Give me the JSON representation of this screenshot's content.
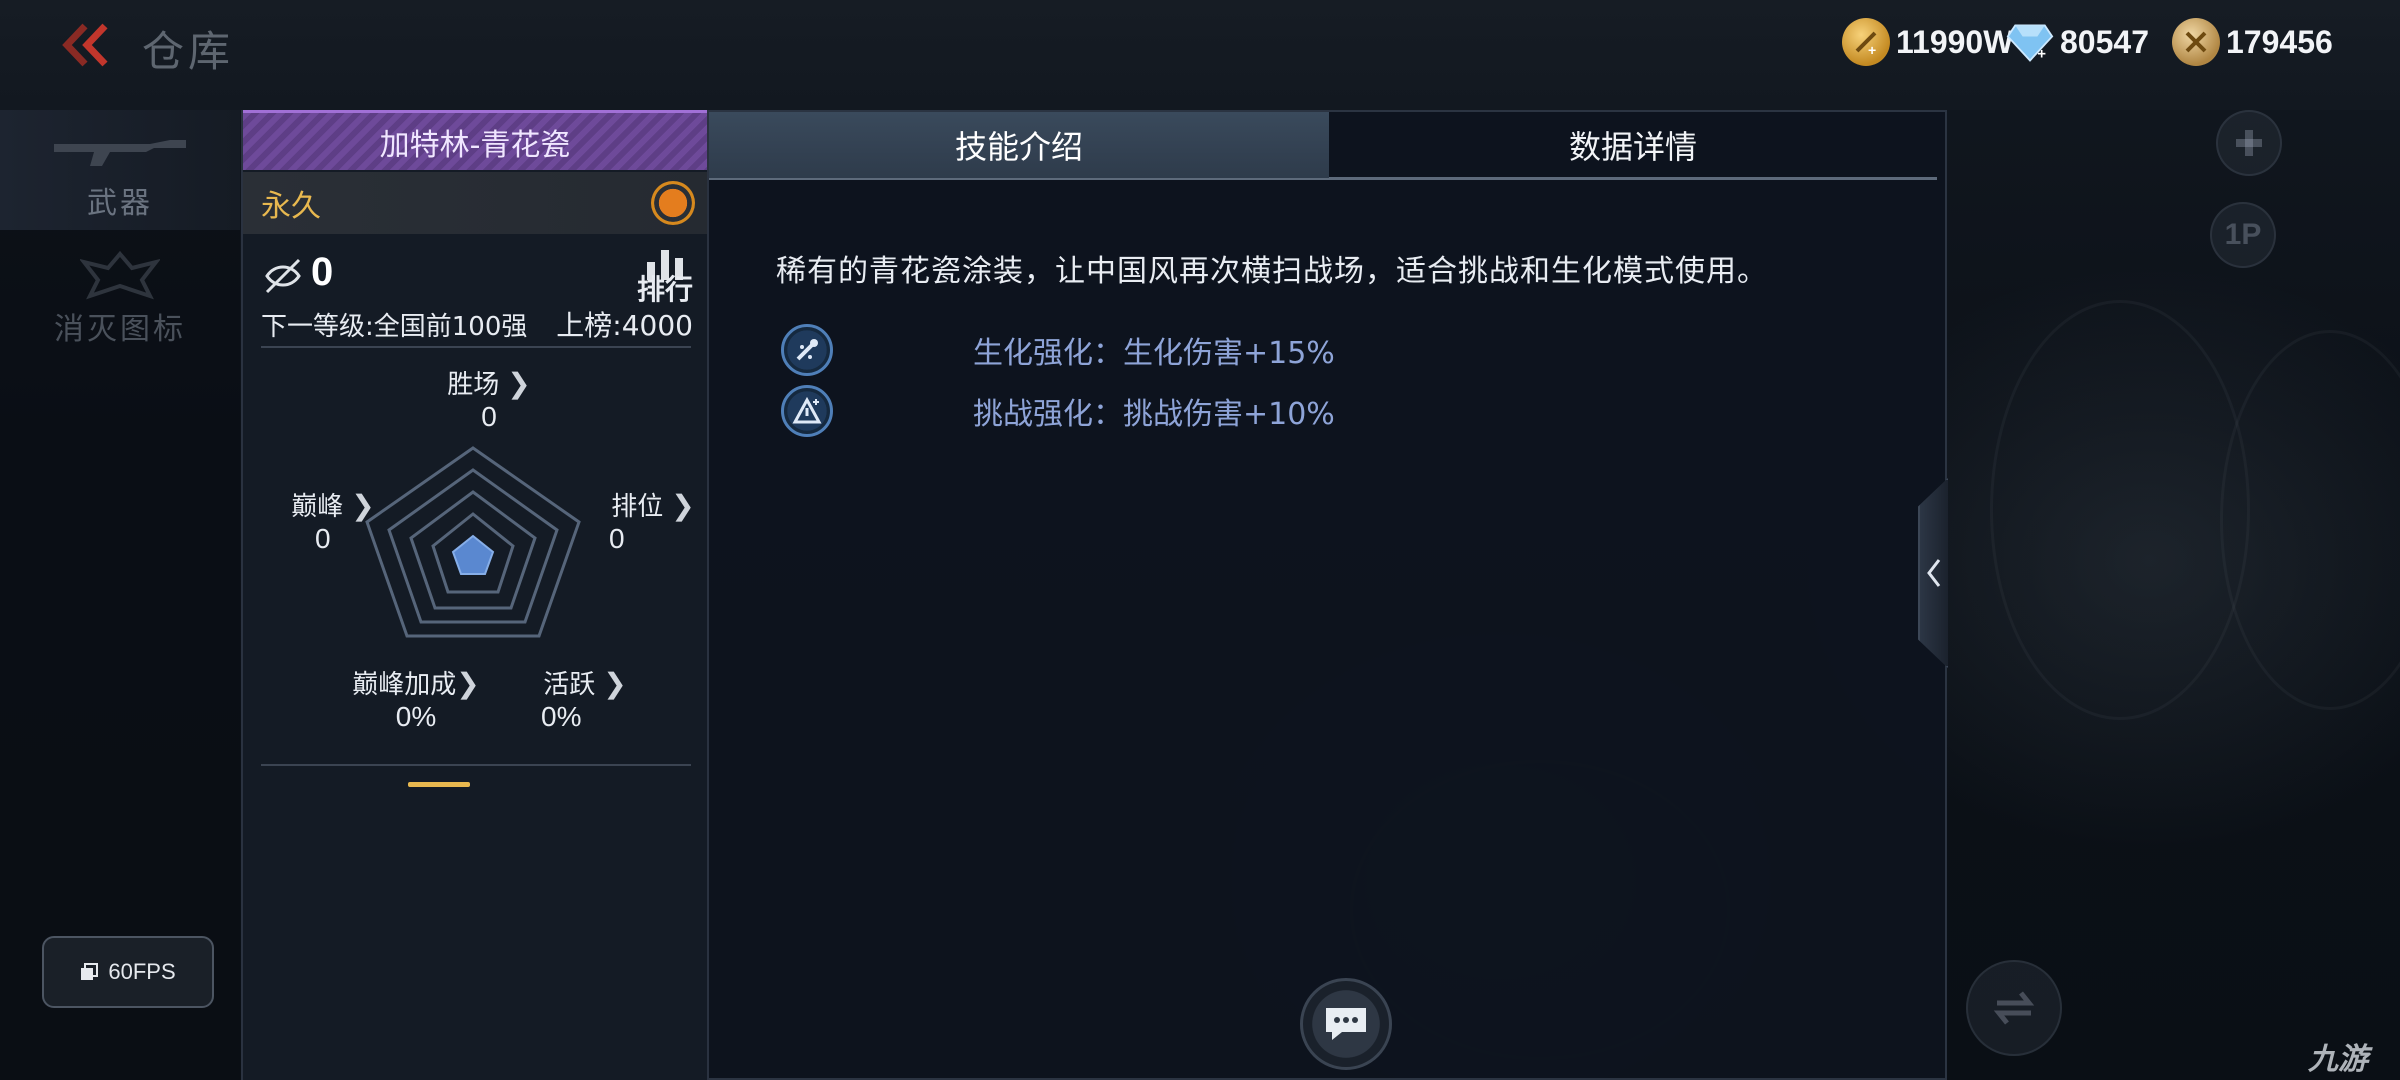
{
  "header": {
    "title": "仓库",
    "currencies": [
      {
        "icon": "gold-coin-icon",
        "value": "11990W"
      },
      {
        "icon": "diamond-icon",
        "value": "80547"
      },
      {
        "icon": "medal-coin-icon",
        "value": "179456"
      }
    ]
  },
  "sidenav": {
    "items": [
      {
        "label": "武器",
        "icon": "rifle-icon",
        "active": true
      },
      {
        "label": "消灭图标",
        "icon": "emblem-icon",
        "active": false
      }
    ]
  },
  "fps": {
    "label": "60FPS"
  },
  "card": {
    "weapon_name": "加特林-青花瓷",
    "duration": "永久",
    "rank_count": "0",
    "rank_button": "排行",
    "next_level": "下一等级:全国前100强",
    "list_rank": "上榜:4000",
    "stats": {
      "wins": {
        "label": "胜场",
        "value": "0"
      },
      "peak": {
        "label": "巅峰",
        "value": "0"
      },
      "ranked": {
        "label": "排位",
        "value": "0"
      },
      "peak_bonus": {
        "label": "巅峰加成",
        "value": "0%"
      },
      "active": {
        "label": "活跃",
        "value": "0%"
      }
    }
  },
  "panel": {
    "tabs": [
      {
        "label": "技能介绍",
        "active": true
      },
      {
        "label": "数据详情",
        "active": false
      }
    ],
    "description": "稀有的青花瓷涂装，让中国风再次横扫战场，适合挑战和生化模式使用。",
    "skills": [
      {
        "icon": "biochem-boost-icon",
        "text": "生化强化：生化伤害+15%"
      },
      {
        "icon": "challenge-boost-icon",
        "text": "挑战强化：挑战伤害+10%"
      }
    ]
  },
  "right_buttons": {
    "p1_label": "1P"
  },
  "watermark": "九游",
  "colors": {
    "accent_purple": "#7a52a8",
    "accent_gold": "#e8b84f",
    "skill_text": "#8ea4d8"
  }
}
